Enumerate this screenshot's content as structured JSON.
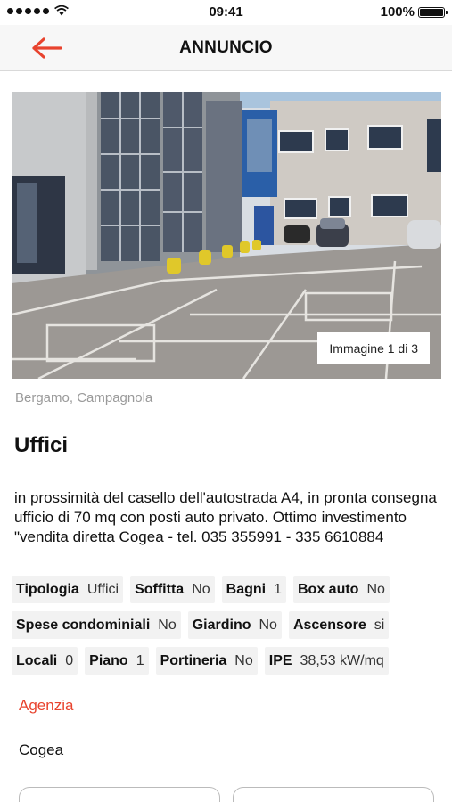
{
  "status": {
    "time": "09:41",
    "battery": "100%"
  },
  "nav": {
    "title": "ANNUNCIO"
  },
  "gallery": {
    "counter": "Immagine 1 di 3"
  },
  "listing": {
    "location": "Bergamo, Campagnola",
    "title": "Uffici",
    "description": "in prossimità del casello dell'autostrada A4, in pronta consegna ufficio di 70 mq con posti auto privato. Ottimo investimento \"vendita diretta Cogea - tel. 035 355991 - 335 6610884"
  },
  "features": [
    [
      {
        "label": "Tipologia",
        "value": "Uffici"
      },
      {
        "label": "Soffitta",
        "value": "No"
      },
      {
        "label": "Bagni",
        "value": "1"
      },
      {
        "label": "Box auto",
        "value": "No"
      }
    ],
    [
      {
        "label": "Spese condominiali",
        "value": "No"
      },
      {
        "label": "Giardino",
        "value": "No"
      },
      {
        "label": "Ascensore",
        "value": "si"
      }
    ],
    [
      {
        "label": "Locali",
        "value": "0"
      },
      {
        "label": "Piano",
        "value": "1"
      },
      {
        "label": "Portineria",
        "value": "No"
      },
      {
        "label": "IPE",
        "value": "38,53 kW/mq"
      }
    ]
  ],
  "agency": {
    "heading": "Agenzia",
    "name": "Cogea"
  },
  "colors": {
    "accent": "#e8432e"
  }
}
